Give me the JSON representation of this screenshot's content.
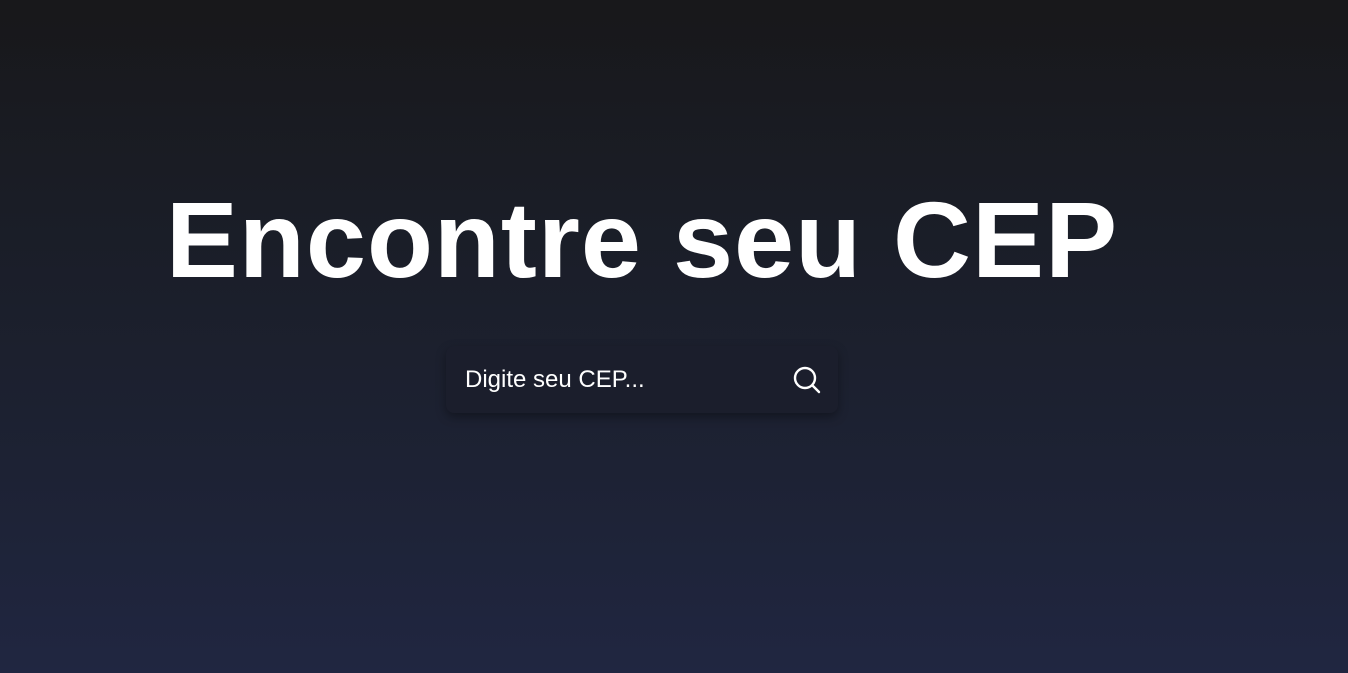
{
  "hero": {
    "title": "Encontre seu CEP"
  },
  "search": {
    "placeholder": "Digite seu CEP...",
    "value": "",
    "button_icon": "search-icon"
  },
  "colors": {
    "background_top": "#18181b",
    "background_bottom": "#202641",
    "search_box": "#1b1e2c",
    "text": "#ffffff"
  }
}
